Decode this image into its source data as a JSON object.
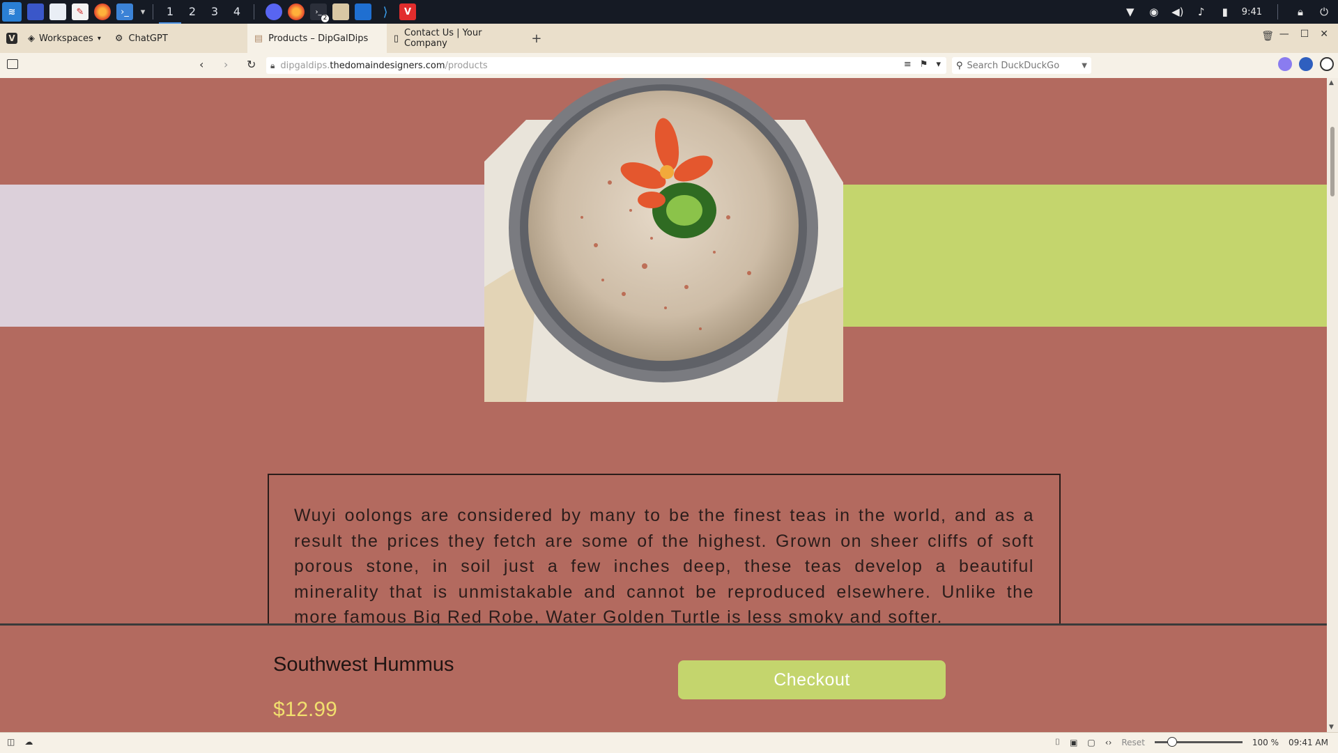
{
  "taskbar": {
    "workspaces": [
      "1",
      "2",
      "3",
      "4"
    ],
    "active_workspace": "1",
    "clock": "9:41",
    "badge": "2"
  },
  "browser": {
    "workspaces_label": "Workspaces",
    "tabs": [
      {
        "label": "ChatGPT",
        "icon": "openai-icon"
      },
      {
        "label": "Products – DipGalDips",
        "icon": "page-icon"
      },
      {
        "label": "Contact Us | Your Company",
        "icon": "document-icon"
      }
    ],
    "active_tab": 1,
    "url": {
      "subdomain": "dipgaldips.",
      "host": "thedomaindesigners.com",
      "path": "/products"
    },
    "search_placeholder": "Search DuckDuckGo"
  },
  "page": {
    "description": "Wuyi oolongs are considered by many to be the finest teas in the world, and as a result the prices they fetch are some of the highest. Grown on sheer cliffs of soft porous stone, in soil just a few inches deep, these teas develop a beautiful minerality that is unmistakable and cannot be reproduced elsewhere. Unlike the more famous Big Red Robe, Water Golden Turtle is less smoky and softer.",
    "product_name": "Southwest Hummus",
    "price": "$12.99",
    "checkout_label": "Checkout",
    "colors": {
      "background": "#b36a5f",
      "band_left": "#dcd0da",
      "band_right": "#c4d56d",
      "button": "#c4d56d",
      "price": "#f1df6e"
    }
  },
  "statusbar": {
    "reset_label": "Reset",
    "zoom": "100 %",
    "time": "09:41 AM"
  }
}
